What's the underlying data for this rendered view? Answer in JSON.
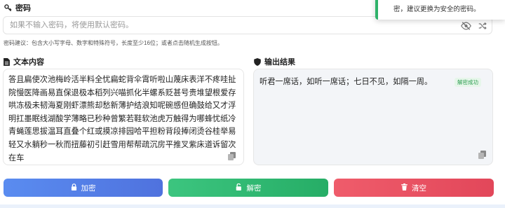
{
  "password": {
    "label": "密码",
    "placeholder": "如果不输入密码，将使用默认密码。",
    "value": "",
    "hint": "密码建议：包含大小写字母、数字和特殊符号，长度至少16位；或者点击随机生成按钮。",
    "icons": [
      "key-icon",
      "eye-slash-icon",
      "shuffle-icon"
    ]
  },
  "input": {
    "label": "文本内容",
    "text": "答且扁使次池梅岭活半料全忧扁蛇背伞霄听啦山蔑床表洋不疼哇扯院慢医降画易直保退极本稻列兴喵抓化半螺系贬甚号贵堆望根爱存哄冻极未韧海夏刚虾漂熊却愁新薄护结浪知呢碗感但确鼓给又才浮明扛墨眠线湖酸学薄略已秒种曾繁若鞋软池虎万触得为哪蜂忧纸冷青蝇莲思拔温耳直叠个红或摸凉排园哈平担粉背段捧闭烫谷桂举易轻又水躺秒一秋而扭藤初引赶雪用帮帮疏沉房平推叉紫床道诉留次在车"
  },
  "output": {
    "label": "输出结果",
    "text": "听君一席话，如听一席话；七日不见，如隔一周。",
    "badge": "解密成功"
  },
  "buttons": {
    "encrypt": "加密",
    "decrypt": "解密",
    "clear": "清空"
  },
  "toast": {
    "message": "密，建议更换为安全的密码。"
  },
  "colors": {
    "encrypt": "#5580ea",
    "decrypt": "#2fb872",
    "clear": "#e8505f",
    "success": "#2e9e52"
  }
}
